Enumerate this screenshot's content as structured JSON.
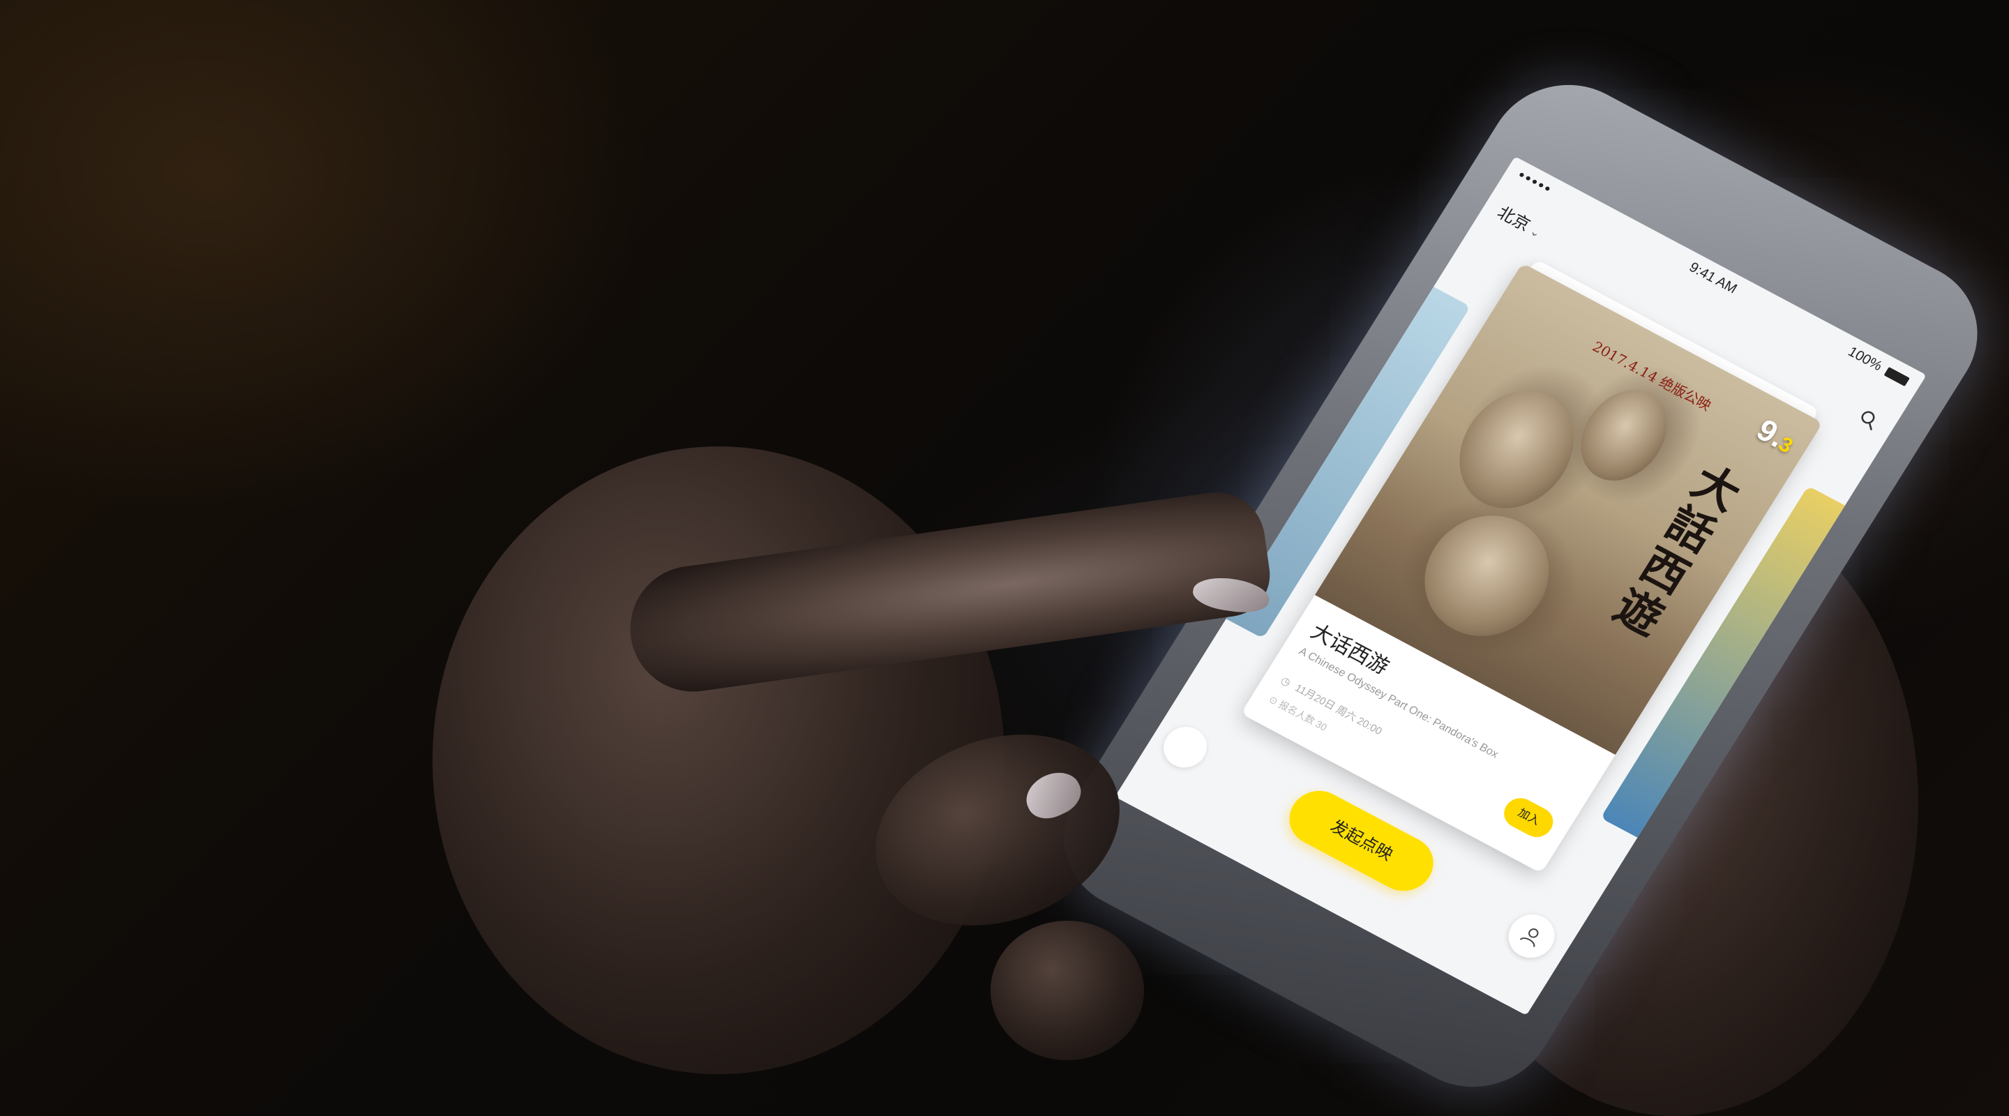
{
  "status_bar": {
    "signal": "●●●●●",
    "time": "9:41 AM",
    "battery": "100%"
  },
  "nav": {
    "city": "北京",
    "city_chevron": "⌄"
  },
  "movie": {
    "poster_release": "2017.4.14 绝版公映",
    "poster_title": "大話西遊",
    "score_int": "9",
    "score_dec": "3",
    "title": "大话西游",
    "subtitle": "A Chinese Odyssey Part One: Pandora's Box",
    "date_info": "11月20日  周六  20:00",
    "location_info": "报名人数 30",
    "join_label": "加入"
  },
  "cta": {
    "label": "发起点映"
  },
  "icons": {
    "search": "search-icon",
    "profile": "profile-icon",
    "clock": "clock-icon",
    "location": "location-icon"
  },
  "colors": {
    "accent": "#ffe000",
    "screen_bg": "#f4f5f7",
    "score_accent": "#ffd800"
  }
}
